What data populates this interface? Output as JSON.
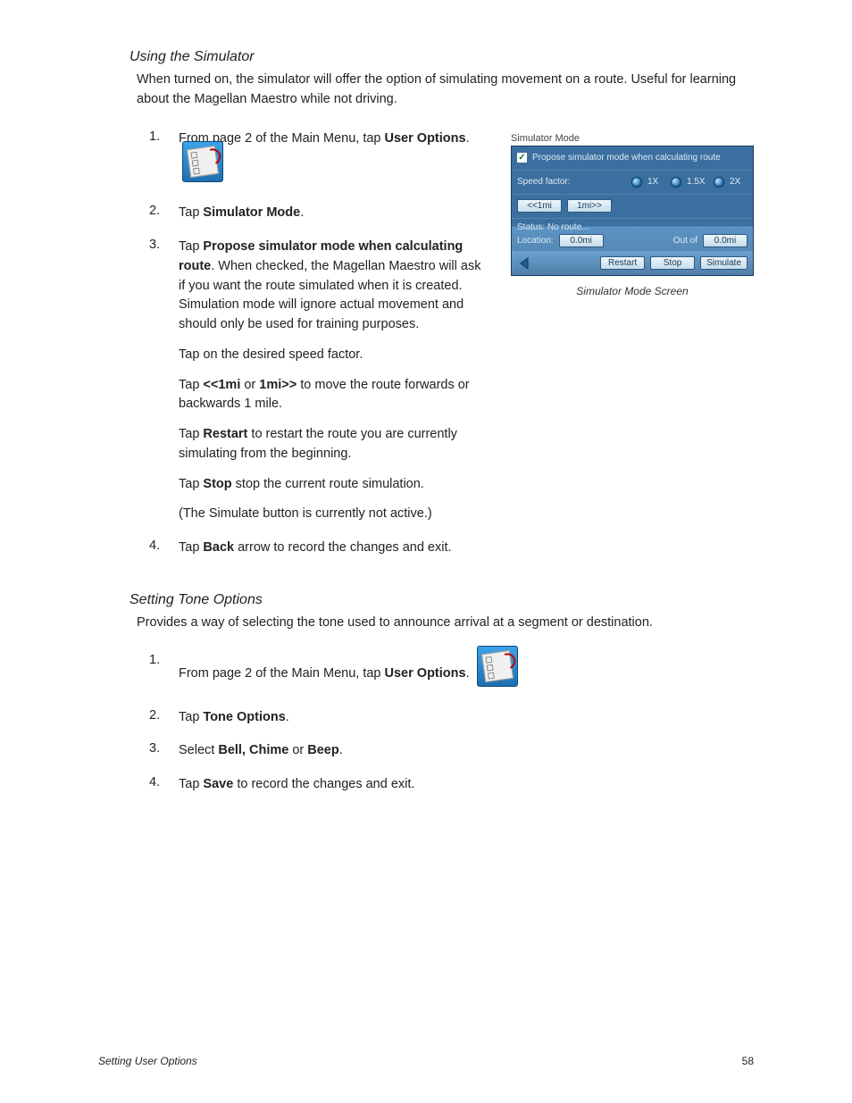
{
  "section1": {
    "title": "Using the Simulator",
    "intro": "When turned on, the simulator will offer the option of simulating movement on a route. Useful for learning about the Magellan Maestro while not driving.",
    "step1_num": "1.",
    "step1_a": "From page 2 of the Main Menu, tap ",
    "step1_b": "User Options",
    "step1_c": ".",
    "step2_num": "2.",
    "step2_a": "Tap ",
    "step2_b": "Simulator Mode",
    "step2_c": ".",
    "step3_num": "3.",
    "step3_a": "Tap ",
    "step3_b": "Propose simulator mode when calculating route",
    "step3_c": ". When checked, the Magellan Maestro will ask if you want the route simulated when it is created. Simulation mode will ignore actual movement and should only be used for training purposes.",
    "step3_p2": "Tap on the desired speed factor.",
    "step3_p3a": "Tap ",
    "step3_p3b": "<<1mi",
    "step3_p3c": " or ",
    "step3_p3d": "1mi>>",
    "step3_p3e": " to move the route forwards or backwards 1 mile.",
    "step3_p4a": "Tap ",
    "step3_p4b": "Restart",
    "step3_p4c": " to restart the route you are currently simulating from the beginning.",
    "step3_p5a": "Tap ",
    "step3_p5b": "Stop",
    "step3_p5c": " stop the current route simulation.",
    "step3_p6": "(The Simulate button is currently not active.)",
    "step4_num": "4.",
    "step4_a": "Tap ",
    "step4_b": "Back",
    "step4_c": " arrow to record the changes and exit."
  },
  "sim": {
    "header": "Simulator Mode",
    "propose": "Propose simulator mode when calculating route",
    "speed_label": "Speed factor:",
    "s1x": "1X",
    "s15x": "1.5X",
    "s2x": "2X",
    "back1": "<<1mi",
    "fwd1": "1mi>>",
    "status": "Status: No route...",
    "loc_label": "Location:",
    "loc_val": "0.0mi",
    "outof": "Out of",
    "total": "0.0mi",
    "restart": "Restart",
    "stop": "Stop",
    "simulate": "Simulate",
    "caption": "Simulator Mode Screen"
  },
  "section2": {
    "title": "Setting Tone Options",
    "intro": "Provides a way of selecting the tone used to announce arrival at a segment or destination.",
    "step1_num": "1.",
    "step1_a": "From page 2 of the Main Menu, tap ",
    "step1_b": "User Options",
    "step1_c": ".",
    "step2_num": "2.",
    "step2_a": "Tap ",
    "step2_b": "Tone Options",
    "step2_c": ".",
    "step3_num": "3.",
    "step3_a": "Select ",
    "step3_b": "Bell, Chime",
    "step3_c": " or ",
    "step3_d": "Beep",
    "step3_e": ".",
    "step4_num": "4.",
    "step4_a": "Tap ",
    "step4_b": "Save",
    "step4_c": " to record the changes and exit."
  },
  "footer": {
    "left": "Setting User Options",
    "page": "58"
  }
}
